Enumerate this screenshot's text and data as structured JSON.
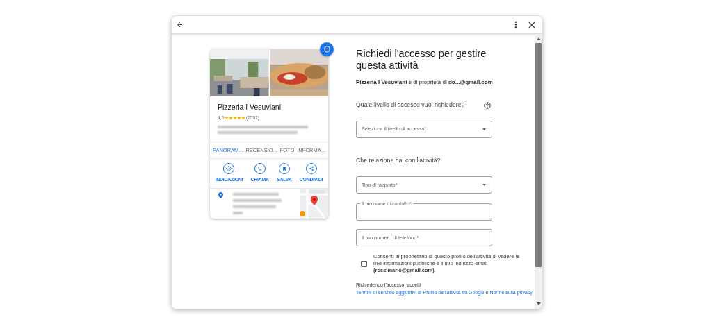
{
  "business": {
    "name": "Pizzeria I Vesuviani",
    "rating": "4,5",
    "stars": 5,
    "review_count": "(2531)",
    "tabs": [
      {
        "label": "PANORAM...",
        "selected": true
      },
      {
        "label": "RECENSIO...",
        "selected": false
      },
      {
        "label": "FOTO",
        "selected": false
      },
      {
        "label": "INFORMA...",
        "selected": false
      }
    ],
    "actions": [
      {
        "kind": "directions",
        "label": "INDICAZIONI"
      },
      {
        "kind": "call",
        "label": "CHIAMA"
      },
      {
        "kind": "save",
        "label": "SALVA"
      },
      {
        "kind": "share",
        "label": "CONDIVIDI"
      }
    ]
  },
  "form": {
    "title": "Richiedi l'accesso per gestire questa attività",
    "owner_line": "**Pizzeria I Vesuviani** è di proprietà di **do...@gmail.com**",
    "fields": [
      {
        "kind": "question",
        "label": "Quale livello di accesso vuoi richiedere?",
        "help": true
      },
      {
        "kind": "select",
        "placeholder": "Seleziona il livello di accesso*"
      },
      {
        "kind": "question",
        "label": "Che relazione hai con l'attività?",
        "help": false
      },
      {
        "kind": "select",
        "placeholder": "Tipo di rapporto*"
      },
      {
        "kind": "outlined",
        "label": "Il tuo nome di contatto*"
      },
      {
        "kind": "input",
        "placeholder": "Il tuo numero di telefono*"
      }
    ],
    "consent": {
      "checked": false,
      "text": "Consenti al proprietario di questo profilo dell'attività di vedere le mie informazioni pubbliche e il mio indirizzo email **(rossimario@gmail.com)**."
    },
    "terms": [
      {
        "kind": "text",
        "text": "Richiedendo l'accesso, accetti "
      },
      {
        "kind": "link",
        "text": "Termini di servizio aggiuntivi di Profilo dell'attività su Google"
      },
      {
        "kind": "text",
        "text": " e "
      },
      {
        "kind": "link",
        "text": "Norme sulla privacy"
      },
      {
        "kind": "text",
        "text": "."
      }
    ]
  }
}
